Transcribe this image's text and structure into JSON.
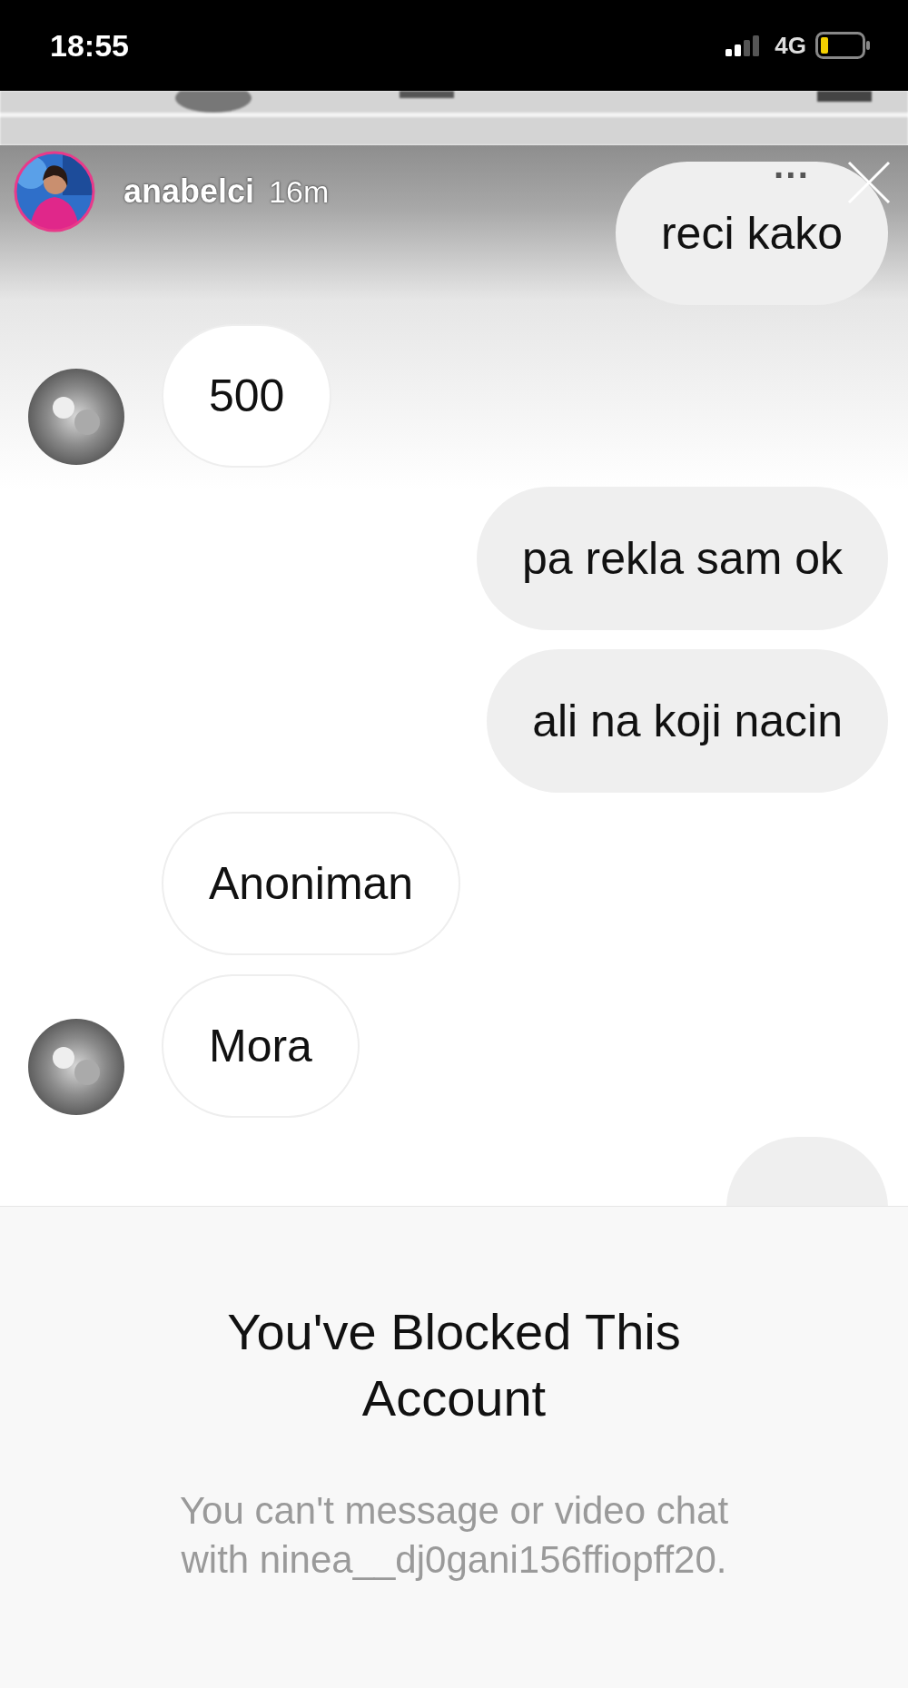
{
  "status_bar": {
    "time": "18:55",
    "network": "4G"
  },
  "story_header": {
    "username": "anabelci",
    "age": "16m",
    "menu": "···"
  },
  "messages": [
    {
      "kind": "outgoing",
      "text": "reci kako",
      "avatar": false
    },
    {
      "kind": "incoming",
      "text": "500",
      "avatar": true
    },
    {
      "kind": "outgoing",
      "text": "pa rekla sam ok",
      "avatar": false
    },
    {
      "kind": "outgoing",
      "text": "ali na koji nacin",
      "avatar": false
    },
    {
      "kind": "incoming",
      "text": "Anoniman",
      "avatar": false
    },
    {
      "kind": "incoming",
      "text": "Mora",
      "avatar": true
    },
    {
      "kind": "outgoing",
      "avatar": false
    }
  ],
  "blocked_notice": {
    "title": "You've Blocked This Account",
    "body": "You can't message or video chat with ninea__dj0gani156ffiopff20."
  }
}
